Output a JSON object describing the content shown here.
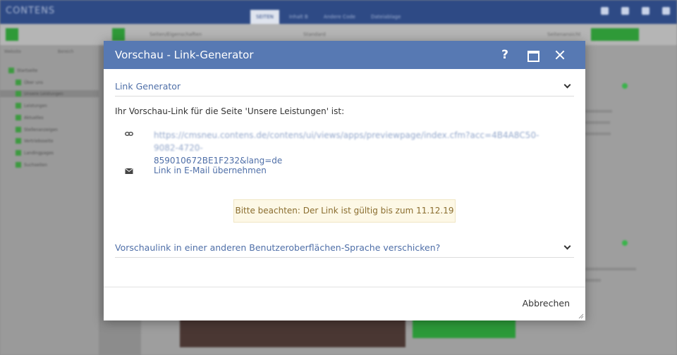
{
  "app": {
    "logo": "CONTENS",
    "top_tabs": [
      "SEITEN",
      "Inhalt B",
      "Andere Code",
      "Dateiablage"
    ],
    "toolbar_search_placeholder": "Seiten/Eigenschaften",
    "toolbar_view": "Standard",
    "toolbar_right_label": "Seitenansicht",
    "sidebar_header_left": "Website",
    "sidebar_header_right": "Bereich",
    "tree_items": [
      "Startseite",
      "Über uns",
      "Unsere Leistungen",
      "Leistungen",
      "Aktuelles",
      "Stellenanzeigen",
      "Vertriebsseite",
      "Landingpages",
      "Suchseiten"
    ]
  },
  "modal": {
    "title": "Vorschau - Link-Generator",
    "help_label": "?",
    "section1_title": "Link Generator",
    "intro_text": "Ihr Vorschau-Link für die Seite 'Unsere Leistungen' ist:",
    "url_part1": "https://cmsneu.contens.de/contens/ui/views/apps/previewpage/index.cfm?acc=4B4A8C50-9082-4720-",
    "url_part2": "859010672BE1F232&lang=de",
    "mail_link": "Link in E-Mail übernehmen",
    "notice": "Bitte beachten: Der Link ist gültig bis zum 11.12.19",
    "section2_title": "Vorschaulink in einer anderen Benutzeroberflächen-Sprache verschicken?",
    "cancel_label": "Abbrechen"
  },
  "colors": {
    "header_blue": "#5779b3",
    "link_blue": "#4f6fa8",
    "notice_bg": "#fdf8e6",
    "notice_text": "#8a6d2f",
    "brand_green": "#2f9a38"
  },
  "icons": [
    "link-icon",
    "mail-icon",
    "help-icon",
    "maximize-icon",
    "close-icon",
    "chevron-down-icon"
  ]
}
